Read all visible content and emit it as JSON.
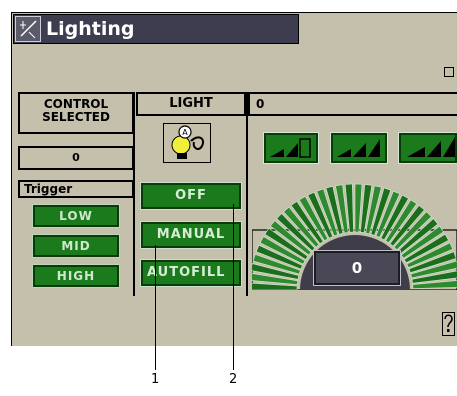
{
  "window": {
    "title": "Lighting",
    "title_icon": "lighting-app-icon"
  },
  "control_panel": {
    "header": "CONTROL SELECTED",
    "value": "0",
    "trigger_label": "Trigger",
    "trigger_buttons": [
      "LOW",
      "MID",
      "HIGH"
    ]
  },
  "light_panel": {
    "header": "LIGHT",
    "icon": "light-bulb-icon",
    "buttons": [
      "OFF",
      "MANUAL",
      "AUTOFILL"
    ]
  },
  "dial_panel": {
    "header": "0",
    "level_buttons": [
      "level-low-icon",
      "level-mid-icon",
      "level-high-icon"
    ],
    "value": "0"
  },
  "help_icon": "help-icon",
  "callouts": [
    "1",
    "2"
  ],
  "colors": {
    "screen_bg": "#c4c0ac",
    "button_green": "#1b7a1b",
    "title_bg": "#3d3d4f"
  }
}
